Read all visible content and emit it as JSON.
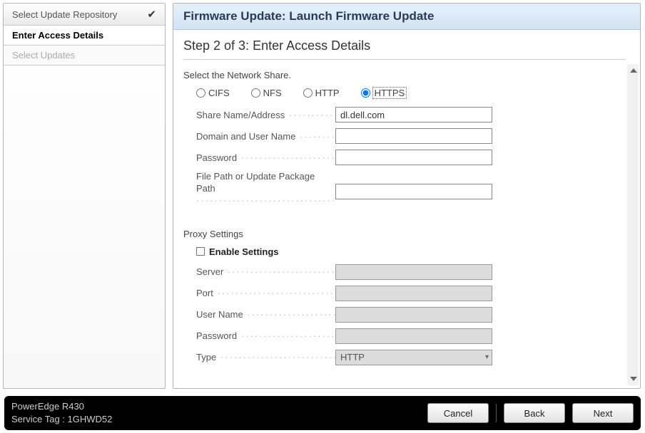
{
  "sidebar": {
    "items": [
      {
        "label": "Select Update Repository",
        "completed": true,
        "active": false,
        "disabled": false
      },
      {
        "label": "Enter Access Details",
        "completed": false,
        "active": true,
        "disabled": false
      },
      {
        "label": "Select Updates",
        "completed": false,
        "active": false,
        "disabled": true
      }
    ]
  },
  "header": {
    "title": "Firmware Update: Launch Firmware Update"
  },
  "step": {
    "heading": "Step 2 of 3: Enter Access Details"
  },
  "network_share": {
    "prompt": "Select the Network Share.",
    "options": {
      "cifs": "CIFS",
      "nfs": "NFS",
      "http": "HTTP",
      "https": "HTTPS"
    },
    "selected": "HTTPS",
    "fields": {
      "share_label": "Share Name/Address",
      "share_value": "dl.dell.com",
      "domain_label": "Domain and User Name",
      "domain_value": "",
      "password_label": "Password",
      "password_value": "",
      "filepath_label_line1": "File Path or Update Package",
      "filepath_label_line2": "Path",
      "filepath_value": ""
    }
  },
  "proxy": {
    "heading": "Proxy Settings",
    "enable_label": "Enable Settings",
    "enabled": false,
    "fields": {
      "server_label": "Server",
      "server_value": "",
      "port_label": "Port",
      "port_value": "",
      "username_label": "User Name",
      "username_value": "",
      "password_label": "Password",
      "password_value": "",
      "type_label": "Type",
      "type_value": "HTTP"
    }
  },
  "footer": {
    "model": "PowerEdge R430",
    "service_tag_label": "Service Tag :",
    "service_tag": "1GHWD52",
    "buttons": {
      "cancel": "Cancel",
      "back": "Back",
      "next": "Next"
    }
  }
}
